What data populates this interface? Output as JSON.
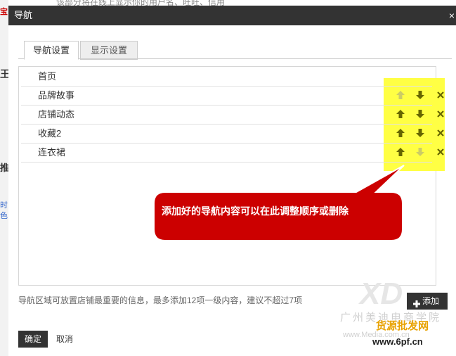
{
  "background": {
    "top_text": "该部分将在线上显示你的用户名、旺旺、信用",
    "left_marks": [
      "宝",
      "王",
      "推",
      "时",
      "色"
    ]
  },
  "dialog": {
    "title": "导航",
    "close_glyph": "×"
  },
  "tabs": [
    {
      "label": "导航设置",
      "active": true
    },
    {
      "label": "显示设置",
      "active": false
    }
  ],
  "nav_items": [
    {
      "label": "首页",
      "controls": false
    },
    {
      "label": "品牌故事",
      "controls": true,
      "up_enabled": false,
      "down_enabled": true
    },
    {
      "label": "店铺动态",
      "controls": true,
      "up_enabled": true,
      "down_enabled": true
    },
    {
      "label": "收藏2",
      "controls": true,
      "up_enabled": true,
      "down_enabled": true
    },
    {
      "label": "连衣裙",
      "controls": true,
      "up_enabled": true,
      "down_enabled": false
    }
  ],
  "callout": {
    "text": "添加好的导航内容可以在此调整顺序或删除"
  },
  "hint": "导航区域可放置店铺最重要的信息，最多添加12项一级内容，建议不超过7项",
  "buttons": {
    "add": "添加",
    "ok": "确定",
    "cancel": "取消"
  },
  "watermark": {
    "big": "XD",
    "line1": "广州美迪电商学院",
    "brand": "货源批发网",
    "url1": "www.Media.com.cn",
    "url2": "www.6pf.cn"
  },
  "colors": {
    "titlebar": "#333333",
    "highlight": "#ffff44",
    "arrow_active": "#666600",
    "arrow_disabled": "#cccc66",
    "callout_fill": "#cc0000"
  }
}
